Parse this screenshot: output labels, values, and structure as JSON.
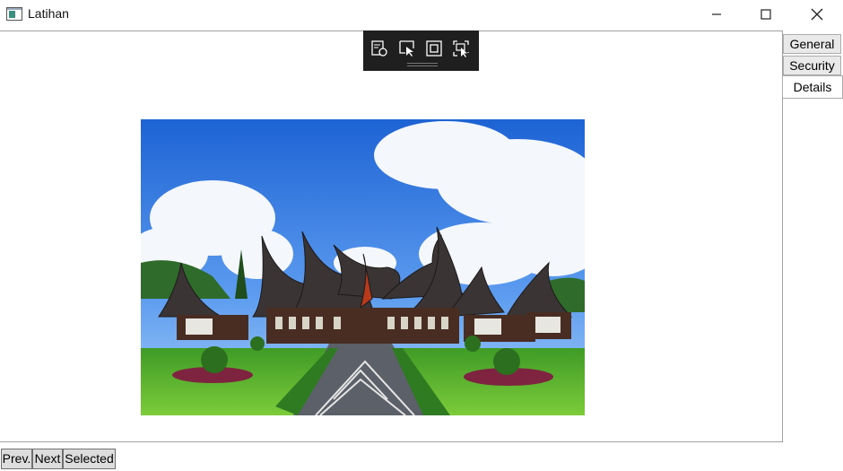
{
  "window": {
    "title": "Latihan",
    "app_icon": "window-app-icon",
    "controls": {
      "minimize": "minimize-icon",
      "maximize": "maximize-icon",
      "close": "close-icon"
    }
  },
  "dev_toolbar": {
    "items": [
      "live-visual-tree-icon",
      "select-element-icon",
      "display-layout-adorners-icon",
      "track-focused-element-icon"
    ]
  },
  "tabs": [
    {
      "label": "General",
      "selected": false
    },
    {
      "label": "Security",
      "selected": false
    },
    {
      "label": "Details",
      "selected": true
    }
  ],
  "image": {
    "subject": "traditional Minangkabau Rumah Gadang palace with garden under blue sky"
  },
  "buttons": {
    "prev": "Prev.",
    "next": "Next",
    "selected": "Selected"
  },
  "colors": {
    "toolbar_bg": "#1f1f1f",
    "button_bg": "#dddddd",
    "tab_bg": "#e9e9e9",
    "border": "#a0a0a0"
  }
}
